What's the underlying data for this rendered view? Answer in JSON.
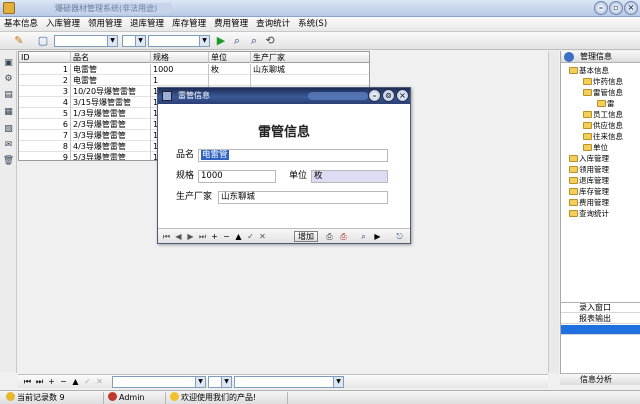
{
  "window": {
    "title": "爆破器材管理系统(非法用途)"
  },
  "menu": [
    "基本信息",
    "入库管理",
    "领用管理",
    "退库管理",
    "库存管理",
    "费用管理",
    "查询统计",
    "系统(S)"
  ],
  "icons": {
    "pencil": "✎",
    "play": "▶",
    "search": "⌕",
    "refresh": "⟲",
    "left_strip": [
      "▣",
      "⚙",
      "▤",
      "▦",
      "▧",
      "✉",
      "🗑"
    ]
  },
  "grid": {
    "columns": [
      "ID",
      "品名",
      "规格",
      "单位",
      "生产厂家"
    ],
    "rows": [
      {
        "id": "1",
        "name": "电雷管",
        "spec": "1000",
        "unit": "枚",
        "maker": "山东聊城"
      },
      {
        "id": "2",
        "name": "电雷管",
        "spec": "1",
        "unit": "",
        "maker": ""
      },
      {
        "id": "3",
        "name": "10/20导爆管雷管",
        "spec": "1",
        "unit": "",
        "maker": ""
      },
      {
        "id": "4",
        "name": "3/15导爆管雷管",
        "spec": "1",
        "unit": "",
        "maker": ""
      },
      {
        "id": "5",
        "name": "1/3导爆管雷管",
        "spec": "1",
        "unit": "",
        "maker": ""
      },
      {
        "id": "6",
        "name": "2/3导爆管雷管",
        "spec": "1",
        "unit": "",
        "maker": ""
      },
      {
        "id": "7",
        "name": "3/3导爆管雷管",
        "spec": "1",
        "unit": "",
        "maker": ""
      },
      {
        "id": "8",
        "name": "4/3导爆管雷管",
        "spec": "1",
        "unit": "",
        "maker": ""
      },
      {
        "id": "9",
        "name": "5/3导爆管雷管",
        "spec": "1",
        "unit": "",
        "maker": ""
      }
    ]
  },
  "dialog": {
    "title": "雷管信息",
    "heading": "雷管信息",
    "fields": {
      "name_label": "品名",
      "name_value": "电雷管",
      "spec_label": "规格",
      "spec_value": "1000",
      "unit_label": "单位",
      "unit_value": "枚",
      "maker_label": "生产厂家",
      "maker_value": "山东聊城"
    },
    "add_label": "增加"
  },
  "tree": {
    "header": "管理信息",
    "items": [
      "基本信息",
      "炸药信息",
      "雷管信息",
      "雷",
      "员工信息",
      "供应信息",
      "往来信息",
      "单位",
      "入库管理",
      "领用管理",
      "退库管理",
      "库存管理",
      "费用管理",
      "查询统计"
    ],
    "list": [
      "录入窗口",
      "报表输出"
    ],
    "footer": "信息分析"
  },
  "status": {
    "record_count": "当前记录数 9",
    "user": "Admin",
    "message": "欢迎使用我们的产品!"
  },
  "colors": {
    "dialog_title": "#2b3f73",
    "selection": "#3163c5"
  }
}
